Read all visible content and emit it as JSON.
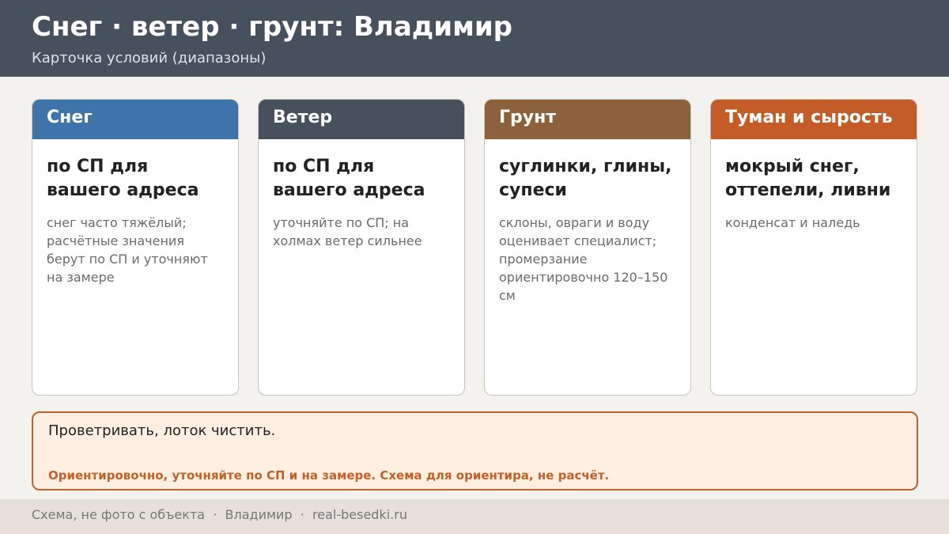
{
  "header": {
    "title": "Снег · ветер · грунт: Владимир",
    "subtitle": "Карточка условий (диапазоны)"
  },
  "cards": [
    {
      "title": "Снег",
      "color": "#3d74a9",
      "main": "по СП для вашего адреса",
      "note": "снег часто тяжёлый; расчётные значения берут по СП и уточняют на замере"
    },
    {
      "title": "Ветер",
      "color": "#47505d",
      "main": "по СП для вашего адреса",
      "note": "уточняйте по СП; на холмах ветер сильнее"
    },
    {
      "title": "Грунт",
      "color": "#8b623b",
      "main": "суглинки, глины, супеси",
      "note": "склоны, овраги и воду оценивает специалист; промерзание ориентировочно 120–150 см"
    },
    {
      "title": "Туман и сырость",
      "color": "#c45c27",
      "main": "мокрый снег, оттепели, ливни",
      "note": "конденсат и наледь"
    }
  ],
  "note_box": {
    "main": "Проветривать, лоток чистить.",
    "warning": "Ориентировочно, уточняйте по СП и на замере. Схема для ориентира, не расчёт."
  },
  "footer": {
    "text": "Схема, не фото с объекта  ·  Владимир  ·  real-besedki.ru"
  },
  "colors": {
    "header_bg": "#47505d",
    "accent": "#c0612a",
    "note_bg": "#feefe2"
  }
}
